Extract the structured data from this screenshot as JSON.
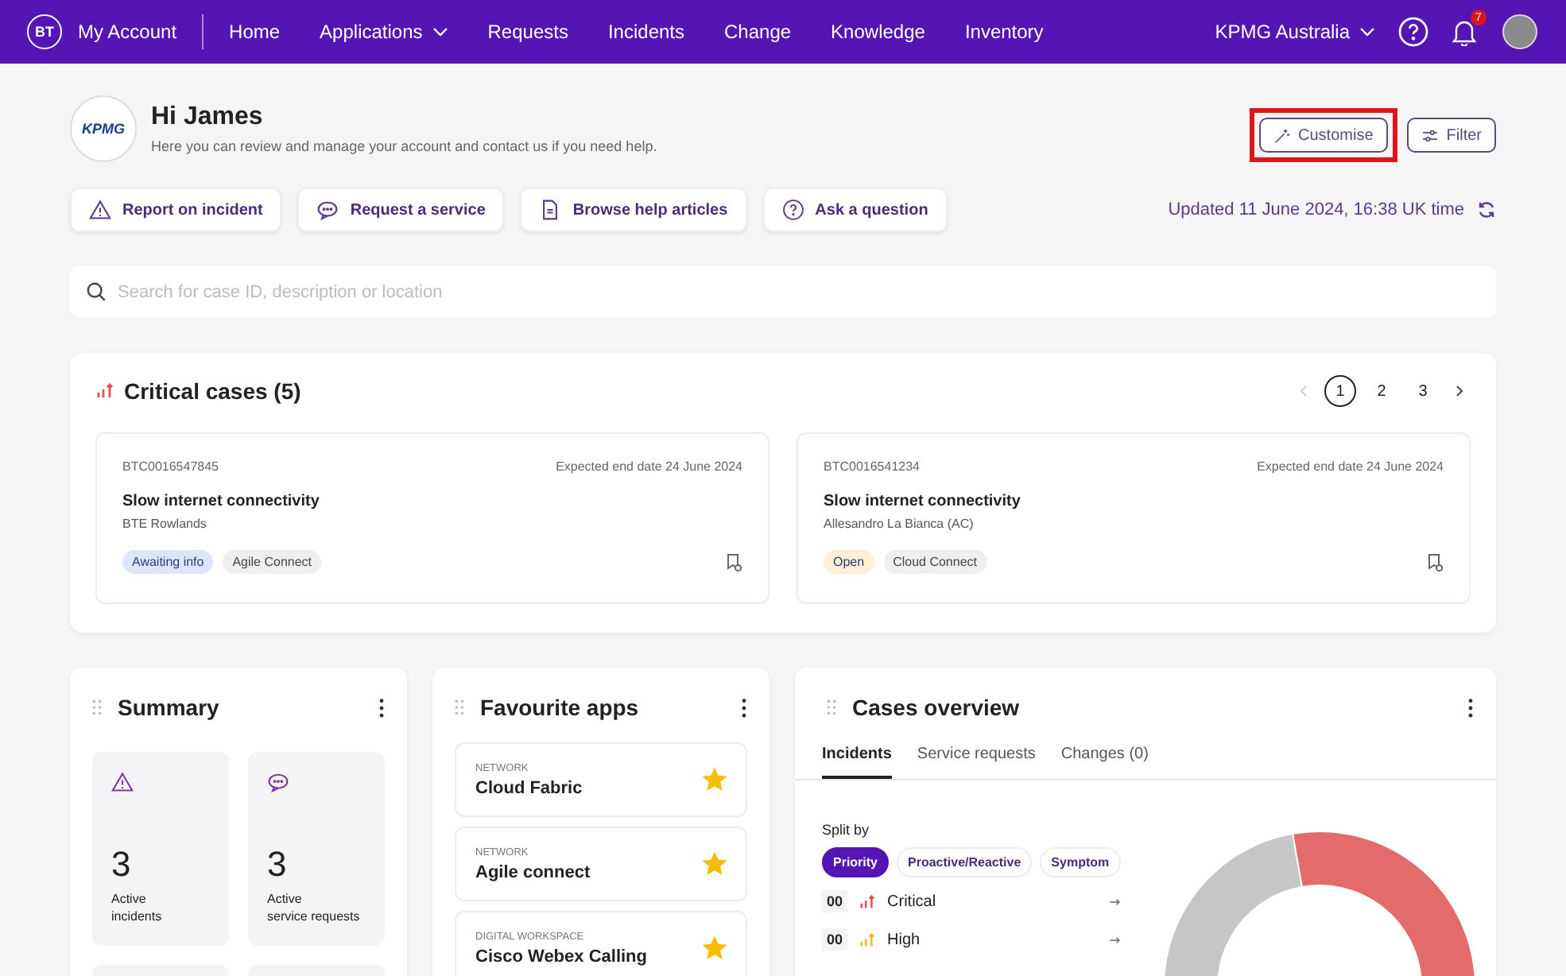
{
  "nav": {
    "brand": "BT",
    "account": "My Account",
    "items": [
      {
        "label": "Home",
        "dropdown": false
      },
      {
        "label": "Applications",
        "dropdown": true
      },
      {
        "label": "Requests",
        "dropdown": false
      },
      {
        "label": "Incidents",
        "dropdown": false
      },
      {
        "label": "Change",
        "dropdown": false
      },
      {
        "label": "Knowledge",
        "dropdown": false
      },
      {
        "label": "Inventory",
        "dropdown": false
      }
    ],
    "org": "KPMG Australia",
    "notifications": "7"
  },
  "header": {
    "logo": "KPMG",
    "greeting": "Hi James",
    "subtitle": "Here you can review and manage your account and contact us if you need help.",
    "buttons": [
      {
        "label": "Customise",
        "kind": "wand",
        "highlighted": true
      },
      {
        "label": "Filter",
        "kind": "sliders",
        "highlighted": false
      }
    ]
  },
  "actions": [
    {
      "label": "Report on incident",
      "kind": "warning"
    },
    {
      "label": "Request a service",
      "kind": "chat"
    },
    {
      "label": "Browse help articles",
      "kind": "document"
    },
    {
      "label": "Ask a question",
      "kind": "question"
    }
  ],
  "updated": "Updated 11 June 2024, 16:38 UK time",
  "search": {
    "placeholder": "Search for case ID, description or location"
  },
  "critical": {
    "title": "Critical cases (5)",
    "pages": [
      {
        "label": "1",
        "selected": true
      },
      {
        "label": "2",
        "selected": false
      },
      {
        "label": "3",
        "selected": false
      }
    ],
    "prev_disabled": true,
    "cases": [
      {
        "id": "BTC0016547845",
        "due": "Expected end date 24 June 2024",
        "title": "Slow internet connectivity",
        "owner": "BTE Rowlands",
        "tags": [
          {
            "label": "Awaiting info",
            "kind": "status",
            "color": "#dde7fb"
          },
          {
            "label": "Agile Connect",
            "kind": "product"
          }
        ]
      },
      {
        "id": "BTC0016541234",
        "due": "Expected end date 24 June 2024",
        "title": "Slow internet connectivity",
        "owner": "Allesandro La Bianca (AC)",
        "tags": [
          {
            "label": "Open",
            "kind": "status",
            "color": "#fdf0d5"
          },
          {
            "label": "Cloud Connect",
            "kind": "product"
          }
        ]
      }
    ]
  },
  "summary": {
    "title": "Summary",
    "tiles": [
      {
        "kind": "warning",
        "value": "3",
        "label": "Active\nincidents"
      },
      {
        "kind": "chat",
        "value": "3",
        "label": "Active\nservice requests"
      }
    ]
  },
  "favourites": {
    "title": "Favourite apps",
    "apps": [
      {
        "category": "NETWORK",
        "name": "Cloud Fabric",
        "starred": true
      },
      {
        "category": "NETWORK",
        "name": "Agile connect",
        "starred": true
      },
      {
        "category": "DIGITAL WORKSPACE",
        "name": "Cisco Webex Calling",
        "starred": true
      }
    ]
  },
  "overview": {
    "title": "Cases overview",
    "tabs": [
      {
        "label": "Incidents",
        "selected": true
      },
      {
        "label": "Service requests",
        "selected": false
      },
      {
        "label": "Changes (0)",
        "selected": false
      }
    ],
    "split_label": "Split by",
    "chips": [
      {
        "label": "Priority",
        "selected": true
      },
      {
        "label": "Proactive/Reactive",
        "selected": false
      },
      {
        "label": "Symptom",
        "selected": false
      }
    ],
    "rows": [
      {
        "count": "00",
        "label": "Critical",
        "color": "#e8504b"
      },
      {
        "count": "00",
        "label": "High",
        "color": "#f2b428"
      }
    ]
  }
}
